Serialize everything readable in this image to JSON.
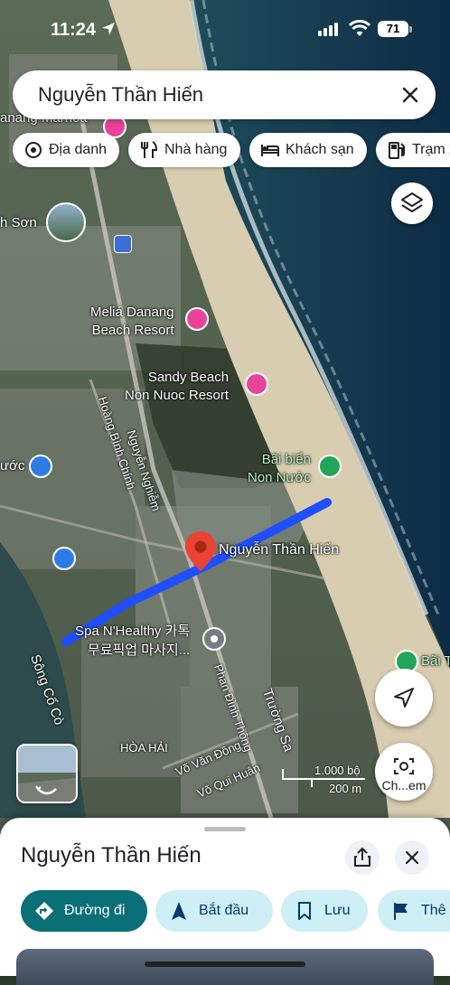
{
  "status_bar": {
    "time": "11:24",
    "battery": "71"
  },
  "search": {
    "query": "Nguyễn Thần Hiến"
  },
  "chips": [
    {
      "label": "Địa danh",
      "icon": "landmark-icon"
    },
    {
      "label": "Nhà hàng",
      "icon": "restaurant-icon"
    },
    {
      "label": "Khách sạn",
      "icon": "hotel-icon"
    },
    {
      "label": "Trạm x",
      "icon": "gas-station-icon"
    }
  ],
  "map_labels": {
    "top_hotel": "anang Marriott",
    "area_son": "h Sơn",
    "melia": "Meliá Danang\nBeach Resort",
    "sandy": "Sandy Beach\nNon Nuoc Resort",
    "beach": "Bãi biển\nNon Nước",
    "pin_label": "Nguyễn Thần Hiến",
    "spa": "Spa N'Healthy 카톡\n무료픽업 마사지...",
    "left_partial": "ước",
    "bai_t": "Bãi T",
    "river": "Sông Cổ Cò",
    "hoa_hai": "HÒA HẢI"
  },
  "streets": {
    "hoang_binh_chinh": "Hoàng Bình Chính",
    "nguyen_nghiem": "Nguyễn Nghiễm",
    "phan_dinh_thong": "Phan Đình Thông",
    "truong_sa": "Trường Sa",
    "vo_van_dong": "Võ Văn Đồng",
    "vo_qui_huan": "Võ Qui Huân"
  },
  "scale": {
    "imperial": "1.000 bộ",
    "metric": "200 m"
  },
  "camera_button": {
    "label": "Ch...em"
  },
  "sheet": {
    "title": "Nguyễn Thần Hiến",
    "actions": [
      {
        "label": "Đường đi",
        "icon": "directions-icon"
      },
      {
        "label": "Bắt đầu",
        "icon": "navigate-icon"
      },
      {
        "label": "Lưu",
        "icon": "bookmark-icon"
      },
      {
        "label": "Thê",
        "icon": "flag-icon"
      }
    ]
  },
  "colors": {
    "route": "#1f4fff",
    "pin": "#ea4335",
    "primary_button": "#0b6f77",
    "secondary_button": "#cdeff5",
    "poi_pink": "#e8439a",
    "poi_blue": "#2c7be5",
    "poi_green": "#22a55a"
  }
}
